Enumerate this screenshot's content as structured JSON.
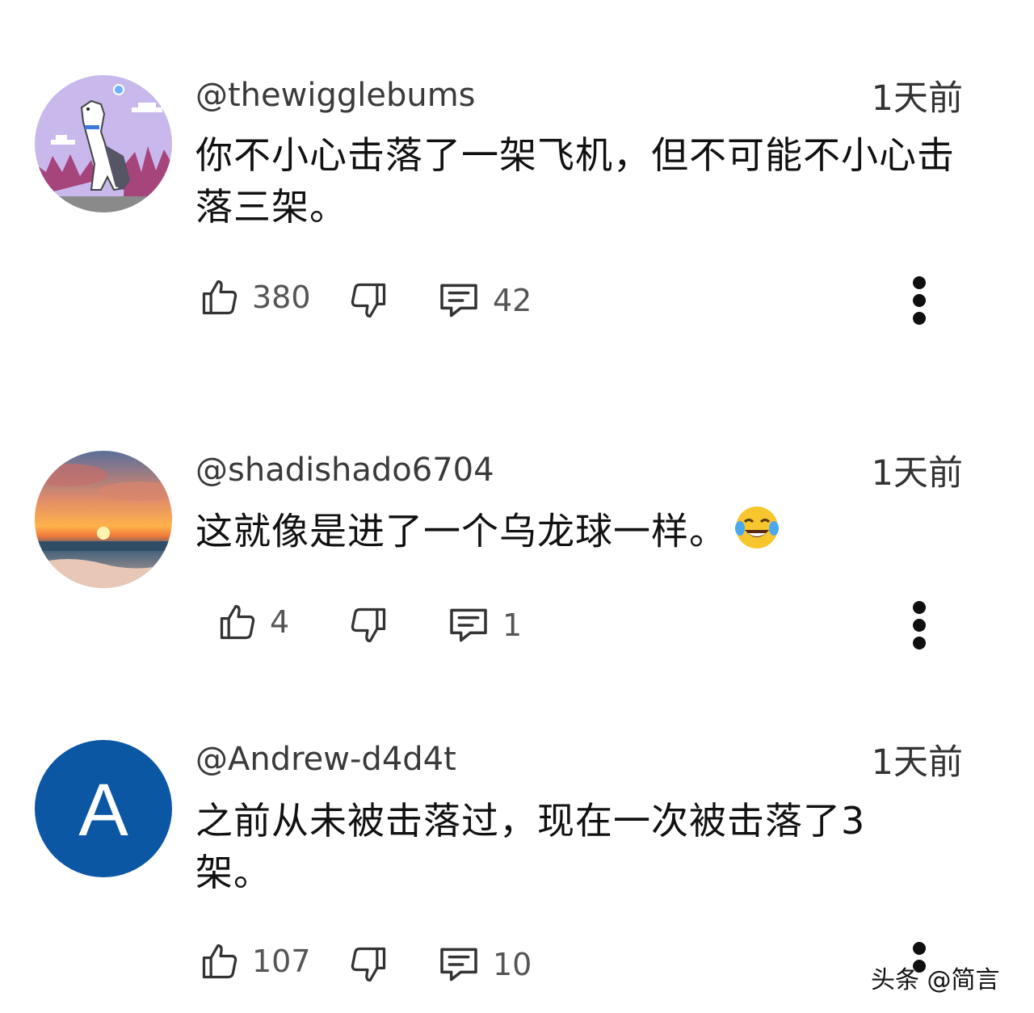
{
  "comments": [
    {
      "username": "@thewigglebums",
      "time": "1天前",
      "text": "你不小心击落了一架飞机，但不可能不小心击落三架。",
      "likes": "380",
      "replies": "42",
      "avatar_type": "illustration-dog"
    },
    {
      "username": "@shadishado6704",
      "time": "1天前",
      "text": "这就像是进了一个乌龙球一样。",
      "emoji": "😂",
      "likes": "4",
      "replies": "1",
      "avatar_type": "photo-sunset"
    },
    {
      "username": "@Andrew-d4d4t",
      "time": "1天前",
      "text": "之前从未被击落过，现在一次被击落了3架。",
      "likes": "107",
      "replies": "10",
      "avatar_type": "letter",
      "avatar_letter": "A",
      "avatar_color": "#0b57a4"
    }
  ],
  "watermark": "头条 @简言",
  "icons": {
    "like": "thumbs-up-icon",
    "dislike": "thumbs-down-icon",
    "reply": "comment-icon",
    "more": "more-vertical-icon"
  }
}
